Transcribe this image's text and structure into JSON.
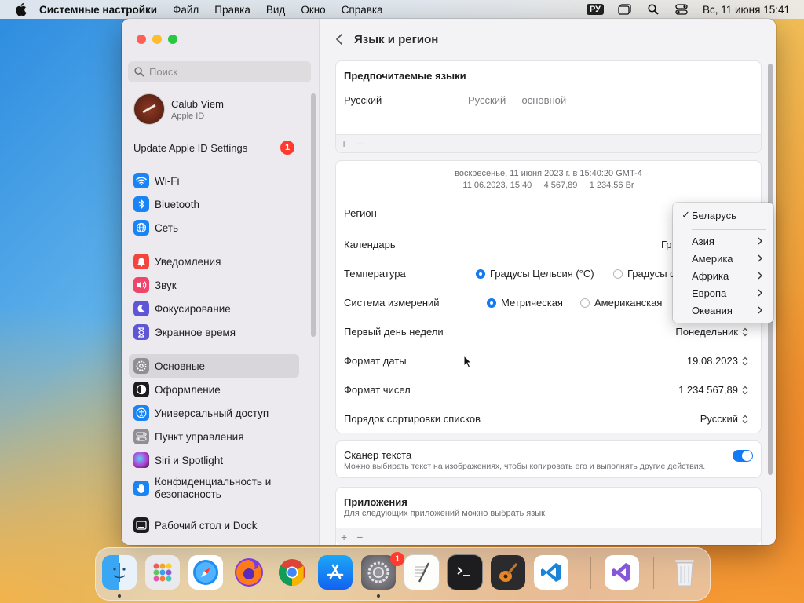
{
  "menubar": {
    "app_name": "Системные настройки",
    "menus": [
      "Файл",
      "Правка",
      "Вид",
      "Окно",
      "Справка"
    ],
    "input_source": "РУ",
    "datetime": "Вс, 11 июня  15:41"
  },
  "sidebar": {
    "search_placeholder": "Поиск",
    "profile_name": "Calub Viem",
    "profile_sub": "Apple ID",
    "update_label": "Update Apple ID Settings",
    "update_badge": "1",
    "group1": [
      {
        "label": "Wi-Fi",
        "icon": "wifi-icon",
        "color": "#1a84f5"
      },
      {
        "label": "Bluetooth",
        "icon": "bluetooth-icon",
        "color": "#1a84f5"
      },
      {
        "label": "Сеть",
        "icon": "network-icon",
        "color": "#1a84f5"
      }
    ],
    "group2": [
      {
        "label": "Уведомления",
        "icon": "notifications-icon",
        "color": "#f4453d"
      },
      {
        "label": "Звук",
        "icon": "sound-icon",
        "color": "#f0456b"
      },
      {
        "label": "Фокусирование",
        "icon": "focus-icon",
        "color": "#5e56d6"
      },
      {
        "label": "Экранное время",
        "icon": "screen-time-icon",
        "color": "#5e56d6"
      }
    ],
    "group3": [
      {
        "label": "Основные",
        "icon": "general-icon",
        "color": "#8e8e93"
      },
      {
        "label": "Оформление",
        "icon": "appearance-icon",
        "color": "#1c1c1e"
      },
      {
        "label": "Универсальный доступ",
        "icon": "accessibility-icon",
        "color": "#1a84f5"
      },
      {
        "label": "Пункт управления",
        "icon": "control-center-icon",
        "color": "#8e8e93"
      },
      {
        "label": "Siri и Spotlight",
        "icon": "siri-icon",
        "color": "#b43cd6"
      },
      {
        "label": "Конфиденциальность и безопасность",
        "icon": "privacy-icon",
        "color": "#1a84f5"
      }
    ],
    "group4": [
      {
        "label": "Рабочий стол и Dock",
        "icon": "desktop-dock-icon",
        "color": "#1c1c1e"
      }
    ]
  },
  "content": {
    "title": "Язык и регион",
    "preferred_header": "Предпочитаемые языки",
    "lang_name": "Русский",
    "lang_desc": "Русский — основной",
    "preview_line1": "воскресенье, 11 июня 2023 г. в 15:40:20 GMT-4",
    "preview_line2_date": "11.06.2023, 15:40",
    "preview_line2_num1": "4 567,89",
    "preview_line2_num2": "1 234,56 Br",
    "region_label": "Регион",
    "calendar_label": "Календарь",
    "calendar_value_partial": "Гр",
    "temperature_label": "Температура",
    "temp_celsius": "Градусы Цельсия (°C)",
    "temp_fahrenheit_partial": "Градусы ф",
    "measure_label": "Система измерений",
    "measure_metric": "Метрическая",
    "measure_us": "Американская",
    "first_day_label": "Первый день недели",
    "first_day_value": "Понедельник",
    "date_format_label": "Формат даты",
    "date_format_value": "19.08.2023",
    "number_format_label": "Формат чисел",
    "number_format_value": "1 234 567,89",
    "sort_label": "Порядок сортировки списков",
    "sort_value": "Русский",
    "scanner_title": "Сканер текста",
    "scanner_desc": "Можно выбирать текст на изображениях, чтобы копировать его и выполнять другие действия.",
    "apps_header": "Приложения",
    "apps_desc": "Для следующих приложений можно выбрать язык:",
    "plus": "+",
    "minus": "−"
  },
  "region_popup": {
    "selected": "Беларусь",
    "check": "✓",
    "items": [
      "Азия",
      "Америка",
      "Африка",
      "Европа",
      "Океания"
    ]
  },
  "dock": {
    "apps": [
      "Finder",
      "Launchpad",
      "Safari",
      "Firefox",
      "Chrome",
      "App Store",
      "System Settings",
      "TextEdit",
      "Terminal",
      "GarageBand",
      "VS Code",
      "Visual Studio",
      "Trash"
    ],
    "settings_badge": "1"
  }
}
